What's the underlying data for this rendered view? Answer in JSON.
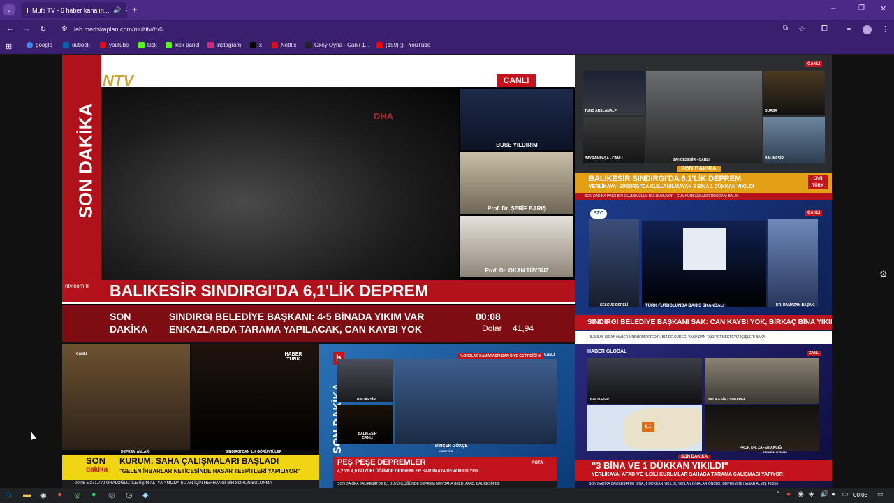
{
  "browser": {
    "tab_title": "Multi TV - 6 haber kanalın...",
    "url": "lab.mertskaplan.com/multitv/tr/6"
  },
  "bookmarks": [
    {
      "label": "google",
      "color": "#4285f4"
    },
    {
      "label": "outlook",
      "color": "#0a64ad"
    },
    {
      "label": "youtube",
      "color": "#ff0000"
    },
    {
      "label": "kick",
      "color": "#53fc18"
    },
    {
      "label": "kick panel",
      "color": "#53fc18"
    },
    {
      "label": "instagram",
      "color": "#d62976"
    },
    {
      "label": "x",
      "color": "#000000"
    },
    {
      "label": "Netflix",
      "color": "#e50914"
    },
    {
      "label": "Okey Oyna - Canlı 1...",
      "color": "#222222"
    },
    {
      "label": "(159) ;) - YouTube",
      "color": "#ff0000"
    }
  ],
  "ntv": {
    "logo": "NTV",
    "canli": "CANLI",
    "side": "SON DAKİKA",
    "dha": "DHA",
    "p1": "BUSE YILDIRIM",
    "p2": "Prof. Dr. ŞERİF BARIŞ",
    "p3": "Prof. Dr. OKAN TÜYSÜZ",
    "logo_small": "ntv.com.tr",
    "headline": "BALIKESİR SINDIRGI'DA 6,1'LİK DEPREM",
    "son": "SON",
    "dakika": "DAKİKA",
    "t1": "SINDIRGI BELEDİYE BAŞKANI: 4-5 BİNADA YIKIM VAR",
    "t2": "ENKAZLARDA TARAMA YAPILACAK, CAN KAYBI YOK",
    "time": "00:08",
    "dolar": "Dolar",
    "dolar_val": "41,94"
  },
  "cnn": {
    "canli": "CANLI",
    "c1": "TUNÇ ARSLANALP",
    "c2": "BAYRAMPAŞA - CANLI",
    "c3": "BAHÇEŞEHİR - CANLI",
    "c4": "BURSA",
    "c5": "BALIKESİR",
    "son": "SON DAKİKA",
    "h1": "BALIKESİR SINDIRGI'DA 6,1'LİK DEPREM",
    "h2": "YERLİKAYA: SINDIRGI'DA KULLANILMAYAN 3 BİNA 1 DÜKKAN YIKILDI",
    "logo": "CNN TÜRK",
    "t": "SON DAKİKA   İANGI BİR OLUMSUZLUK BULUNMUYOR  •  CUMHURBAŞKANI ERDOĞAN: BALIK"
  },
  "szc": {
    "logo": "SZC",
    "canli": "CANLI",
    "p1": "SELÇUK DERELİ",
    "p2": "DR. RAMAZAN BAŞAK",
    "caption": "TÜRK FUTBOLUNDA BAHİS SKANDALI",
    "headline": "SINDIRGI BELEDİYE BAŞKANI SAK: CAN KAYBI YOK, BİRKAÇ BİNA YIKILDI",
    "t": "5.366,96  SICAK HABER  ÜRDÜRMEKTEDİR. BİZ DE SÜRECİ YAKINDAN TAKİP ETMEKTEYİZ  İÇİŞLERİ BAKA"
  },
  "haberturk": {
    "logo": "HABER TÜRK",
    "canli": "CANLI",
    "l1": "DEPREM ANLARI",
    "l2": "SINDIRGI'DAN İLK GÖRÜNTÜLER",
    "son": "SON",
    "dakika": "dakika",
    "h1": "KURUM: SAHA ÇALIŞMALARI BAŞLADI",
    "h2": "\"GELEN İHBARLAR NETİCESİNDE HASAR TESPİTLERİ YAPILIYOR\"",
    "t": "00:08  5.371.770  URALOĞLU: İLETİŞİM ALTYAPIMIZDA ŞU AN İÇİN HERHANGİ BİR SORUN BULUNMA"
  },
  "halk": {
    "logo": "h",
    "canli": "CANLI",
    "side": "SON DAKİKA",
    "l1": "BALIKESİR",
    "l2": "BALIKESİR CANLI",
    "banner": "\"LORDLAR KAMARASI'NDAN DİYE GETİRDİĞİ H",
    "name": "DİNÇER GÖKÇE",
    "role": "GAZETECİ",
    "h1": "PEŞ PEŞE DEPREMLER",
    "h2": "4,2 VE 4,0 BÜYÜKLÜĞÜNDE DEPREMLER SARSMAYA DEVAM EDİYOR",
    "rota": "ROTA",
    "t": "SON DAKİKA  BALIKESİR'DE 6,1 BÜYÜKLÜĞÜNDE DEPREM MEYDANA GELDİ  AFAD: BALIKESİR'DE"
  },
  "global": {
    "logo": "HABER GLOBAL",
    "canli": "CANLI",
    "l1": "BALIKESİR",
    "l2": "BALIKESİR / SINDIRGI",
    "l3": "PROF. DR. ZAFER AKÇIĞ",
    "l4": "DEPREM UZMANI",
    "mag": "6.1",
    "son": "SON DAKİKA",
    "h1": "\"3 BİNA VE 1 DÜKKAN YIKILDI\"",
    "h2": "YERLİKAYA: AFAD VE İLGİLİ KURUMLAR SAHADA TARAMA ÇALIŞMASI YAPIYOR",
    "t": "SON DAKİKA  BALIKESİR'DE BİNA, 1 DÜKKAN YIKILDI, YIKILAN BİNALAR ÖNCEKİ DEPREMDE HASAR ALMIŞ  48.556"
  },
  "taskbar": {
    "time": "00:08"
  }
}
